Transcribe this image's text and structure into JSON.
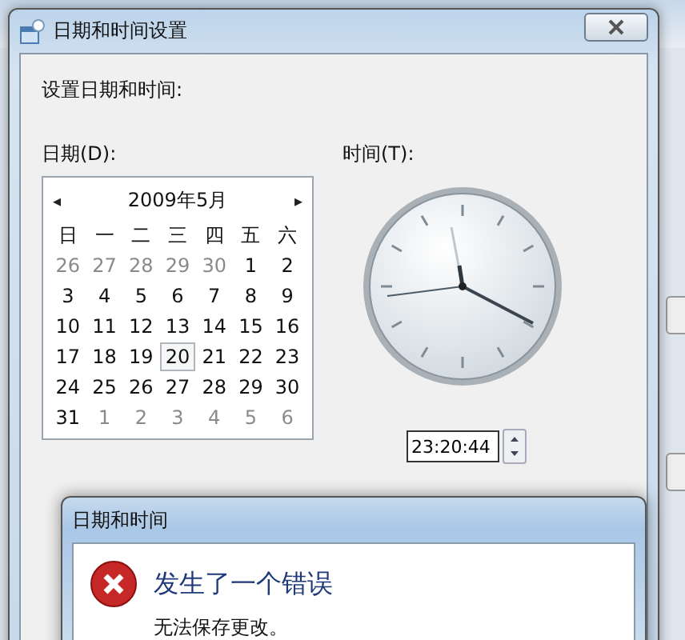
{
  "window": {
    "title": "日期和时间设置"
  },
  "heading": "设置日期和时间:",
  "date_label": "日期(D):",
  "time_label": "时间(T):",
  "calendar": {
    "month": "2009年5月",
    "prev": "◂",
    "next": "▸",
    "weekdays": [
      "日",
      "一",
      "二",
      "三",
      "四",
      "五",
      "六"
    ],
    "weeks": [
      [
        {
          "day": "26",
          "other_month": true,
          "selected": false
        },
        {
          "day": "27",
          "other_month": true,
          "selected": false
        },
        {
          "day": "28",
          "other_month": true,
          "selected": false
        },
        {
          "day": "29",
          "other_month": true,
          "selected": false
        },
        {
          "day": "30",
          "other_month": true,
          "selected": false
        },
        {
          "day": "1",
          "other_month": false,
          "selected": false
        },
        {
          "day": "2",
          "other_month": false,
          "selected": false
        }
      ],
      [
        {
          "day": "3",
          "other_month": false,
          "selected": false
        },
        {
          "day": "4",
          "other_month": false,
          "selected": false
        },
        {
          "day": "5",
          "other_month": false,
          "selected": false
        },
        {
          "day": "6",
          "other_month": false,
          "selected": false
        },
        {
          "day": "7",
          "other_month": false,
          "selected": false
        },
        {
          "day": "8",
          "other_month": false,
          "selected": false
        },
        {
          "day": "9",
          "other_month": false,
          "selected": false
        }
      ],
      [
        {
          "day": "10",
          "other_month": false,
          "selected": false
        },
        {
          "day": "11",
          "other_month": false,
          "selected": false
        },
        {
          "day": "12",
          "other_month": false,
          "selected": false
        },
        {
          "day": "13",
          "other_month": false,
          "selected": false
        },
        {
          "day": "14",
          "other_month": false,
          "selected": false
        },
        {
          "day": "15",
          "other_month": false,
          "selected": false
        },
        {
          "day": "16",
          "other_month": false,
          "selected": false
        }
      ],
      [
        {
          "day": "17",
          "other_month": false,
          "selected": false
        },
        {
          "day": "18",
          "other_month": false,
          "selected": false
        },
        {
          "day": "19",
          "other_month": false,
          "selected": false
        },
        {
          "day": "20",
          "other_month": false,
          "selected": true
        },
        {
          "day": "21",
          "other_month": false,
          "selected": false
        },
        {
          "day": "22",
          "other_month": false,
          "selected": false
        },
        {
          "day": "23",
          "other_month": false,
          "selected": false
        }
      ],
      [
        {
          "day": "24",
          "other_month": false,
          "selected": false
        },
        {
          "day": "25",
          "other_month": false,
          "selected": false
        },
        {
          "day": "26",
          "other_month": false,
          "selected": false
        },
        {
          "day": "27",
          "other_month": false,
          "selected": false
        },
        {
          "day": "28",
          "other_month": false,
          "selected": false
        },
        {
          "day": "29",
          "other_month": false,
          "selected": false
        },
        {
          "day": "30",
          "other_month": false,
          "selected": false
        }
      ],
      [
        {
          "day": "31",
          "other_month": false,
          "selected": false
        },
        {
          "day": "1",
          "other_month": true,
          "selected": false
        },
        {
          "day": "2",
          "other_month": true,
          "selected": false
        },
        {
          "day": "3",
          "other_month": true,
          "selected": false
        },
        {
          "day": "4",
          "other_month": true,
          "selected": false
        },
        {
          "day": "5",
          "other_month": true,
          "selected": false
        },
        {
          "day": "6",
          "other_month": true,
          "selected": false
        }
      ]
    ]
  },
  "time": {
    "value": "23:20:44"
  },
  "error_dialog": {
    "title": "日期和时间",
    "heading": "发生了一个错误",
    "message": "无法保存更改。"
  }
}
